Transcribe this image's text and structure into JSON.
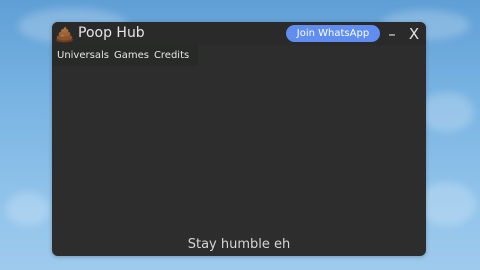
{
  "window": {
    "title": "Poop Hub",
    "logo_icon": "poop-emoji-icon",
    "join_button_label": "Join WhatsApp",
    "minimize_label": "–",
    "close_label": "X"
  },
  "tabs": [
    {
      "label": "Universals"
    },
    {
      "label": "Games"
    },
    {
      "label": "Credits"
    }
  ],
  "footer": {
    "text": "Stay humble eh"
  },
  "colors": {
    "background_sky": "#78b3e2",
    "window_bg": "#2d2d2d",
    "tab_bar_bg": "#282a28",
    "accent_button": "#5f8ef0",
    "text": "#e6e6e6"
  }
}
